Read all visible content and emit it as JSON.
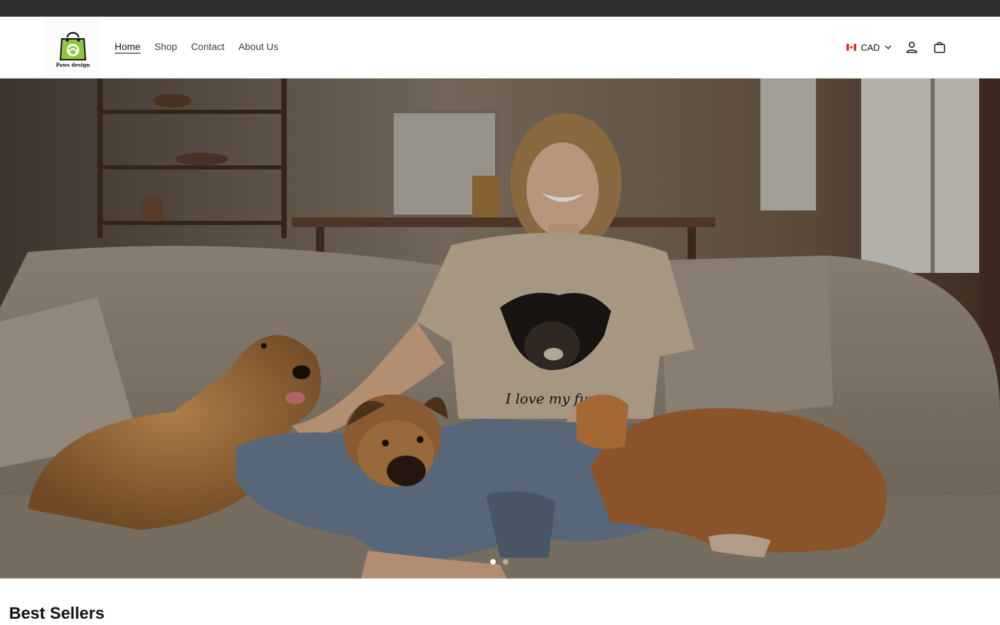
{
  "brand": {
    "logo_text": "Paws design",
    "logo_color": "#8dc63f"
  },
  "nav": {
    "items": [
      {
        "label": "Home",
        "active": true
      },
      {
        "label": "Shop",
        "active": false
      },
      {
        "label": "Contact",
        "active": false
      },
      {
        "label": "About Us",
        "active": false
      }
    ]
  },
  "header_tools": {
    "currency": "CAD",
    "flag_icon": "canada-flag-icon",
    "account_icon": "account-icon",
    "cart_icon": "shopping-bag-icon"
  },
  "hero": {
    "image_alt": "Woman sitting on a sofa with three dogs wearing a dog portrait t-shirt",
    "shirt_script": "I love my furry",
    "slides": 2,
    "active_slide": 1
  },
  "sections": {
    "best_sellers_title": "Best Sellers"
  },
  "colors": {
    "announcement_bar": "#2f2f2f",
    "accent": "#8dc63f",
    "text": "#121212"
  }
}
